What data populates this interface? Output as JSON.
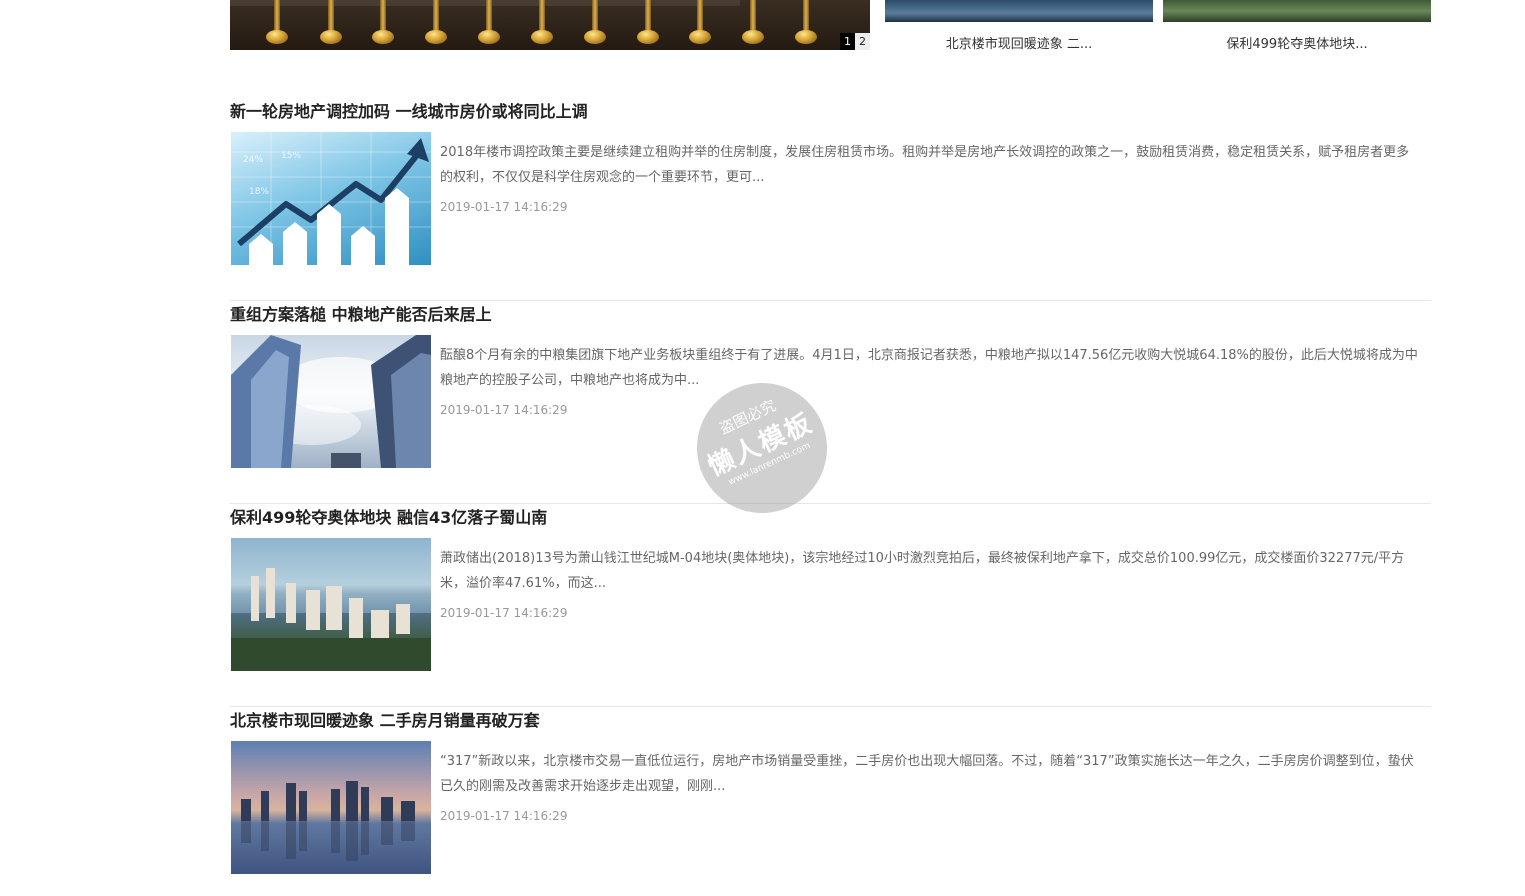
{
  "slider": {
    "pages": [
      "1",
      "2"
    ],
    "active_page": "1"
  },
  "thumbs": [
    {
      "caption": "北京楼市现回暖迹象 二..."
    },
    {
      "caption": "保利499轮夺奥体地块..."
    }
  ],
  "articles": [
    {
      "title": "新一轮房地产调控加码 一线城市房价或将同比上调",
      "summary": "2018年楼市调控政策主要是继续建立租购并举的住房制度，发展住房租赁市场。租购并举是房地产长效调控的政策之一，鼓励租赁消费，稳定租赁关系，赋予租房者更多的权利，不仅仅是科学住房观念的一个重要环节，更可...",
      "date": "2019-01-17 14:16:29",
      "image_labels": [
        "24%",
        "15%",
        "18%"
      ]
    },
    {
      "title": "重组方案落槌 中粮地产能否后来居上",
      "summary": "酝酿8个月有余的中粮集团旗下地产业务板块重组终于有了进展。4月1日，北京商报记者获悉，中粮地产拟以147.56亿元收购大悦城64.18%的股份，此后大悦城将成为中粮地产的控股子公司，中粮地产也将成为中...",
      "date": "2019-01-17 14:16:29"
    },
    {
      "title": "保利499轮夺奥体地块 融信43亿落子蜀山南",
      "summary": "萧政储出(2018)13号为萧山钱江世纪城M-04地块(奥体地块)，该宗地经过10小时激烈竞拍后，最终被保利地产拿下，成交总价100.99亿元，成交楼面价32277元/平方米，溢价率47.61%，而这...",
      "date": "2019-01-17 14:16:29"
    },
    {
      "title": "北京楼市现回暖迹象 二手房月销量再破万套",
      "summary": "“317”新政以来，北京楼市交易一直低位运行，房地产市场销量受重挫，二手房价也出现大幅回落。不过，随着“317”政策实施长达一年之久，二手房房价调整到位，蛰伏已久的刚需及改善需求开始逐步走出观望，刚刚...",
      "date": "2019-01-17 14:16:29"
    }
  ],
  "watermark": {
    "line1": "盗图必究",
    "line2": "懒人模板",
    "line3": "www.lanrenmb.com"
  }
}
